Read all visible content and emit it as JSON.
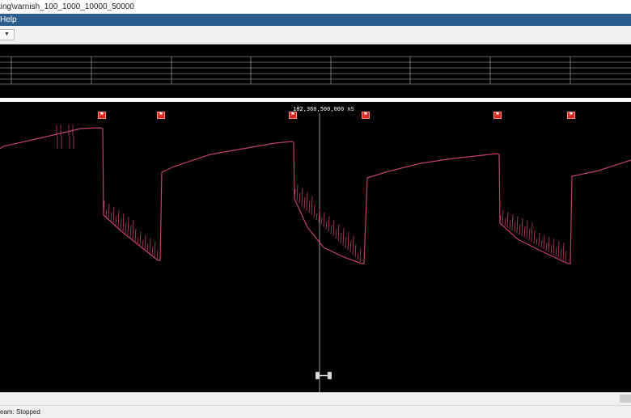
{
  "window": {
    "title": "ting\\varnish_100_1000_10000_50000"
  },
  "menubar": {
    "items": [
      {
        "label": "Help"
      }
    ]
  },
  "timeline": {
    "cursor_label": "182,360,500,000 nS",
    "trace_color": "#c0406e",
    "marker_color": "#d9281f",
    "markers": [
      {
        "icon": "bookmark-icon"
      },
      {
        "icon": "bookmark-icon"
      },
      {
        "icon": "bookmark-icon"
      },
      {
        "icon": "bookmark-icon"
      },
      {
        "icon": "bookmark-icon"
      },
      {
        "icon": "bookmark-icon"
      }
    ]
  },
  "statusbar": {
    "text": "eam:  Stopped"
  }
}
